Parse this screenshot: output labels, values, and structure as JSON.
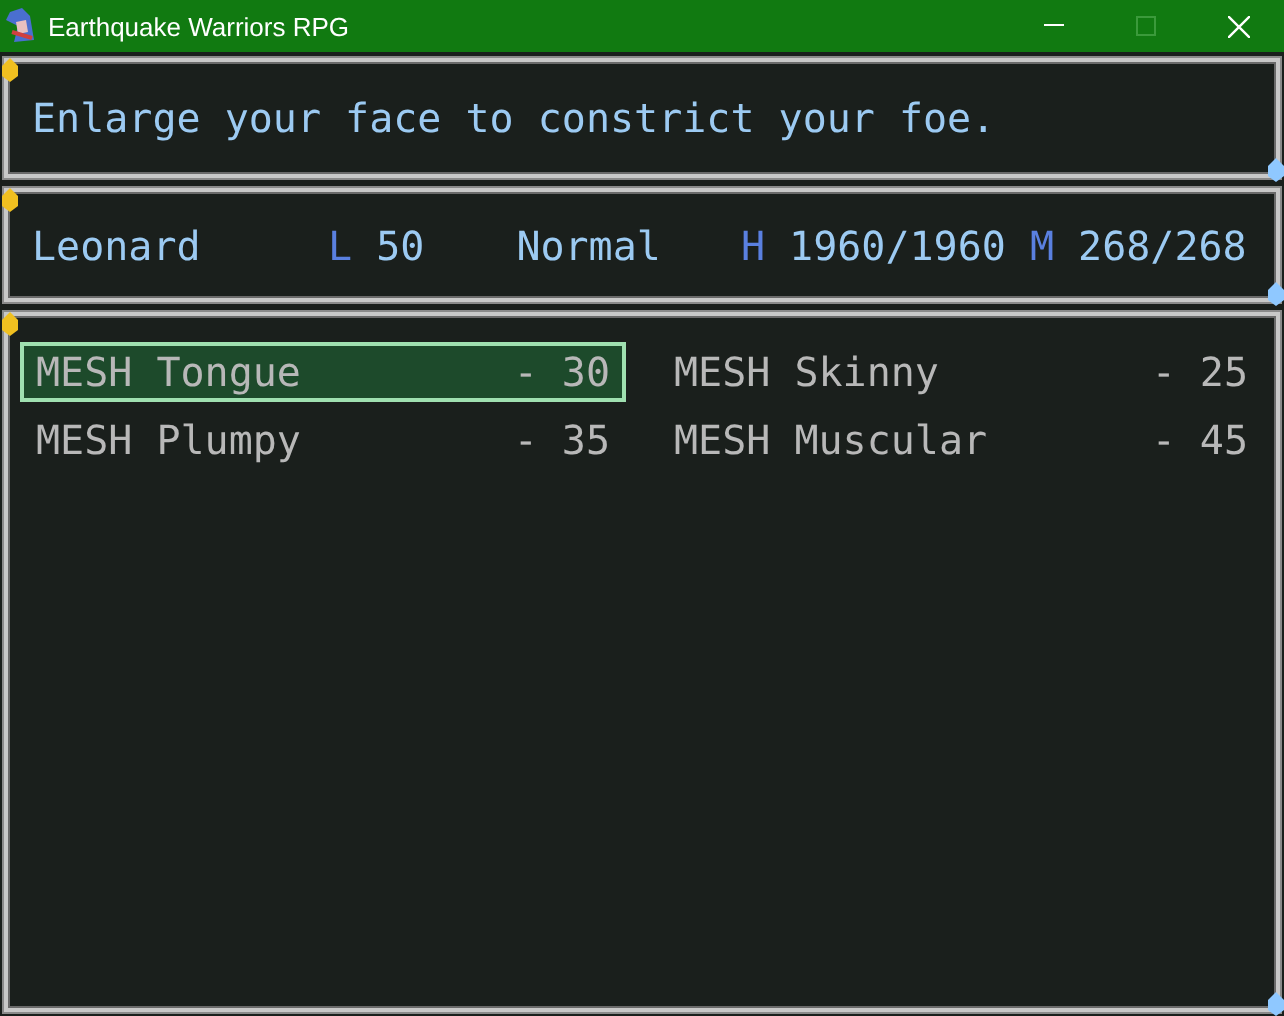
{
  "window": {
    "title": "Earthquake Warriors RPG"
  },
  "help": {
    "text": "Enlarge your face to constrict your foe."
  },
  "status": {
    "name": "Leonard",
    "level_label": "L",
    "level": "50",
    "condition": "Normal",
    "hp_label": "H",
    "hp": "1960/1960",
    "mp_label": "M",
    "mp": "268/268"
  },
  "skills": [
    {
      "name": "MESH Tongue",
      "cost": "- 30",
      "selected": true
    },
    {
      "name": "MESH Skinny",
      "cost": "- 25",
      "selected": false
    },
    {
      "name": "MESH Plumpy",
      "cost": "- 35",
      "selected": false
    },
    {
      "name": "MESH Muscular",
      "cost": "- 45",
      "selected": false
    }
  ]
}
